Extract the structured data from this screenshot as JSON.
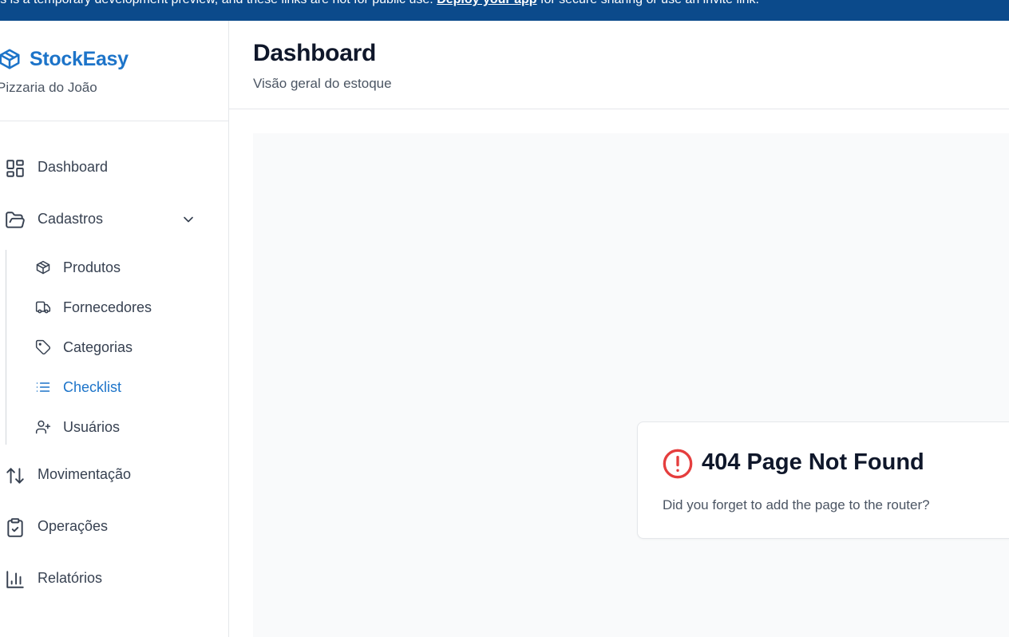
{
  "banner": {
    "text_before": "This is a temporary development preview, and these links are not for public use. ",
    "link": "Deploy your app",
    "text_after": " for secure sharing or use an invite link."
  },
  "brand": {
    "name": "StockEasy",
    "subtitle": "Pizzaria do João",
    "icon": "package-icon",
    "color": "#1d74c9"
  },
  "sidebar": {
    "items": [
      {
        "label": "Dashboard",
        "icon": "layout-dashboard-icon"
      },
      {
        "label": "Cadastros",
        "icon": "folder-open-icon",
        "expanded": true
      },
      {
        "label": "Movimentação",
        "icon": "arrow-up-down-icon"
      },
      {
        "label": "Operações",
        "icon": "clipboard-check-icon"
      },
      {
        "label": "Relatórios",
        "icon": "bar-chart-icon"
      }
    ],
    "cadastros_sub": [
      {
        "label": "Produtos",
        "icon": "package-icon"
      },
      {
        "label": "Fornecedores",
        "icon": "truck-icon"
      },
      {
        "label": "Categorias",
        "icon": "tag-icon"
      },
      {
        "label": "Checklist",
        "icon": "list-icon",
        "active": true
      },
      {
        "label": "Usuários",
        "icon": "user-plus-icon"
      }
    ]
  },
  "header": {
    "title": "Dashboard",
    "subtitle": "Visão geral do estoque"
  },
  "error_card": {
    "title": "404 Page Not Found",
    "message": "Did you forget to add the page to the router?",
    "icon": "alert-circle-icon",
    "color": "#e53e3e"
  }
}
